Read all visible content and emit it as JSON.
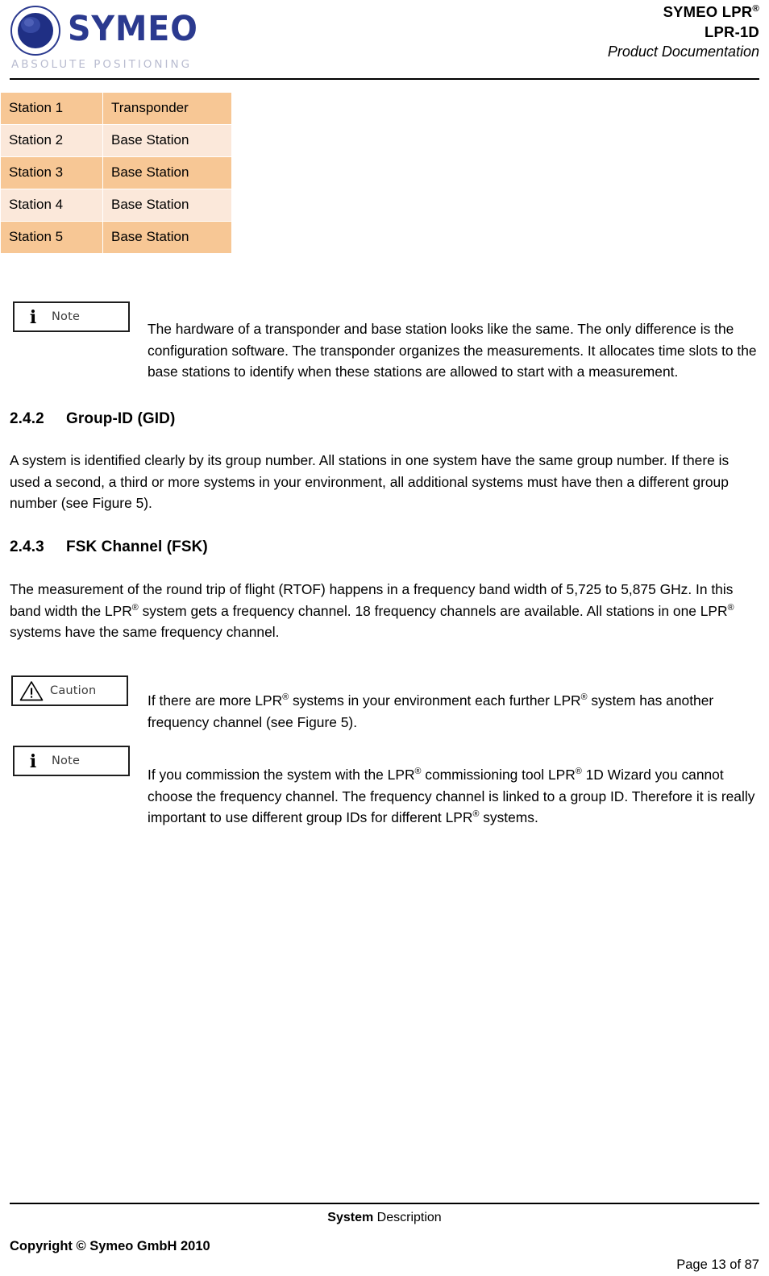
{
  "header": {
    "logo": {
      "wordmark": "SYMEO",
      "tagline": "ABSOLUTE POSITIONING",
      "mark_color": "#2b3a8f"
    },
    "title_line1": "SYMEO LPR",
    "title_line1_sup": "®",
    "title_line2": "LPR-1D",
    "title_line3": "Product Documentation"
  },
  "table": {
    "rows": [
      {
        "station": "Station 1",
        "role": "Transponder"
      },
      {
        "station": "Station 2",
        "role": "Base Station"
      },
      {
        "station": "Station 3",
        "role": "Base Station"
      },
      {
        "station": "Station 4",
        "role": "Base Station"
      },
      {
        "station": "Station 5",
        "role": "Base Station"
      }
    ],
    "odd_row_color": "#f7c795",
    "even_row_color": "#fbe8da"
  },
  "note1": {
    "icon": "i",
    "label": "Note",
    "text": "The hardware of a transponder and base station looks like the same. The only difference is the configuration software. The transponder organizes the measurements. It allocates time slots to the base stations to identify when these stations are allowed to start with a measurement."
  },
  "section_242": {
    "number": "2.4.2",
    "title": "Group-ID (GID)",
    "paragraph": "A system is identified clearly by its group number. All stations in one system have the same group number. If there is used a second, a third or more systems in your environment, all additional systems must have then a different group number (see Figure 5)."
  },
  "section_243": {
    "number": "2.4.3",
    "title": "FSK Channel (FSK)",
    "paragraph_part1": "The measurement of the round trip of flight (RTOF) happens in a frequency band width of 5,725 to 5,875 GHz. In this band width the LPR",
    "paragraph_part2": " system gets a frequency channel. 18 frequency channels are available. All stations in one LPR",
    "paragraph_part3": " systems have the same frequency channel.",
    "sup": "®"
  },
  "caution": {
    "icon": "!",
    "label": "Caution",
    "text_part1": "If there are more LPR",
    "text_part2": " systems in your environment each further LPR",
    "text_part3": " system has another frequency channel (see Figure 5).",
    "sup": "®"
  },
  "note2": {
    "icon": "i",
    "label": "Note",
    "text_part1": "If you commission the system with the LPR",
    "text_part2": " commissioning tool LPR",
    "text_part3": " 1D Wizard you cannot choose the frequency channel. The frequency channel is linked to a group ID. Therefore it is really important to use different group IDs for different LPR",
    "text_part4": " systems.",
    "sup": "®"
  },
  "footer": {
    "center_bold": "System",
    "center_rest": " Description",
    "copyright": "Copyright © Symeo GmbH 2010",
    "page": "Page 13 of 87"
  }
}
